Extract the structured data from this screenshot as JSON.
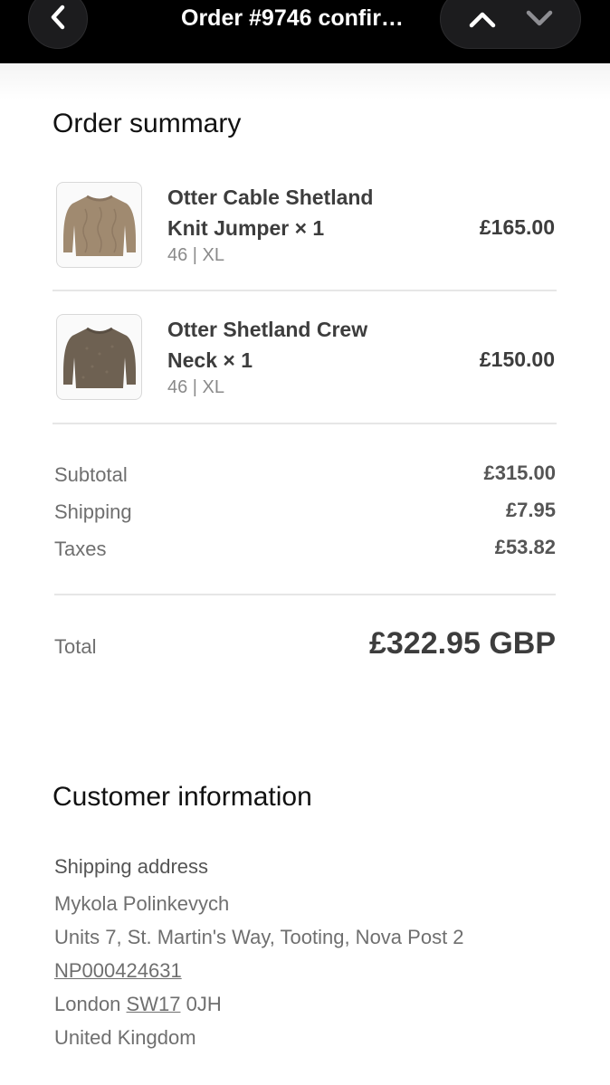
{
  "header": {
    "title": "Order #9746 confir…"
  },
  "order_summary": {
    "heading": "Order summary",
    "items": [
      {
        "name": "Otter Cable Shetland Knit Jumper × 1",
        "name_line1": "Otter Cable Shetland",
        "name_line2": "Knit Jumper × 1",
        "variant": "46 | XL",
        "price": "£165.00",
        "thumb_color": "#a08a70"
      },
      {
        "name": "Otter Shetland Crew Neck × 1",
        "name_line1": "Otter Shetland Crew",
        "name_line2": "Neck × 1",
        "variant": "46 | XL",
        "price": "£150.00",
        "thumb_color": "#6e6152"
      }
    ],
    "subtotal_label": "Subtotal",
    "subtotal_value": "£315.00",
    "shipping_label": "Shipping",
    "shipping_value": "£7.95",
    "taxes_label": "Taxes",
    "taxes_value": "£53.82",
    "total_label": "Total",
    "total_value": "£322.95 GBP"
  },
  "customer_information": {
    "heading": "Customer information",
    "shipping_address_label": "Shipping address",
    "name": "Mykola Polinkevych",
    "line1": "Units 7, St. Martin's Way, Tooting, Nova Post 2",
    "line2": "NP000424631",
    "city": "London",
    "postcode_part1": "SW17",
    "postcode_part2": "0JH",
    "country": "United Kingdom"
  },
  "icons": {
    "back": "chevron-left-icon",
    "previous": "chevron-up-icon",
    "next": "chevron-down-icon"
  }
}
